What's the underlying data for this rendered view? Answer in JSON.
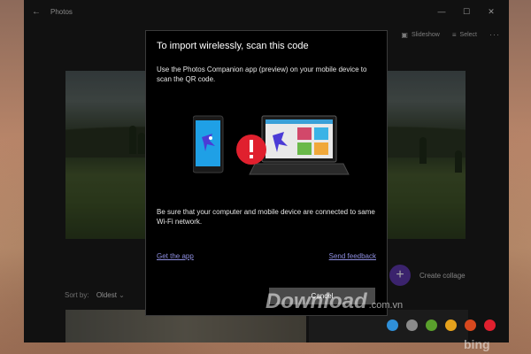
{
  "window": {
    "title": "Photos"
  },
  "toolbar": {
    "slideshow": "Slideshow",
    "select": "Select"
  },
  "main": {
    "sort_label": "Sort by:",
    "sort_value": "Oldest",
    "create_collage": "Create collage"
  },
  "dialog": {
    "title": "To import wirelessly, scan this code",
    "instructions": "Use the Photos Companion app (preview) on your mobile device to scan the QR code.",
    "network_note": "Be sure that your computer and mobile device are connected to same Wi-Fi network.",
    "get_app_link": "Get the app",
    "feedback_link": "Send feedback",
    "cancel_label": "Cancel"
  },
  "watermark": {
    "brand": "Download",
    "tld": ".com.vn",
    "footer_brand": "bing"
  },
  "colors": {
    "accent": "#5b36a8",
    "error_red": "#e0202e",
    "link": "#8e8ee0",
    "dot_colors": [
      "#2f8fd8",
      "#8a8a8a",
      "#5aa02c",
      "#e6a21c",
      "#d8481e",
      "#e0202e"
    ]
  }
}
